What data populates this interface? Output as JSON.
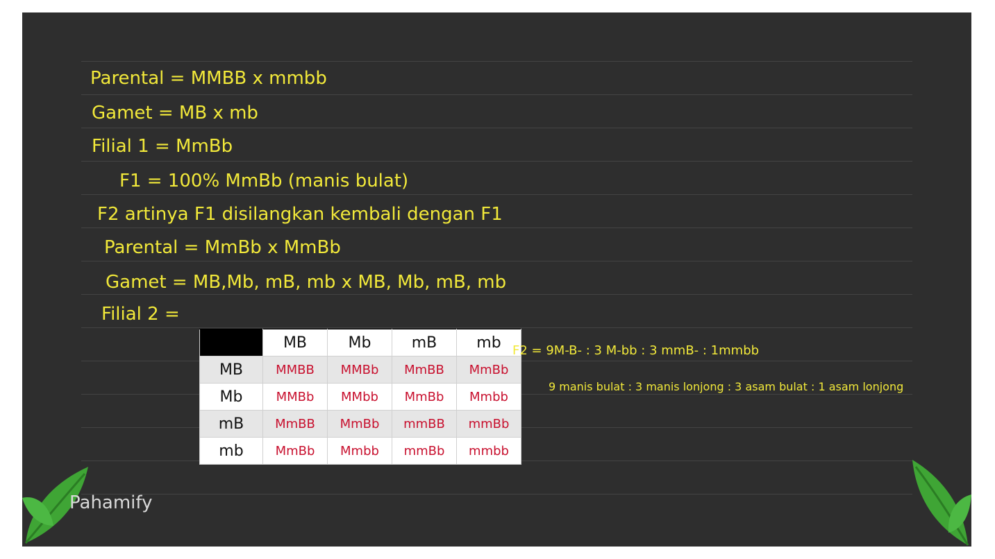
{
  "lines": [
    "Parental = MMBB x mmbb",
    "Gamet = MB x mb",
    "Filial 1 = MmBb",
    "F1 = 100% MmBb (manis bulat)",
    "F2 artinya F1 disilangkan kembali dengan F1",
    "Parental = MmBb x MmBb",
    "Gamet = MB,Mb, mB, mb x MB, Mb, mB, mb",
    "Filial 2 ="
  ],
  "punnett": {
    "columns": [
      "MB",
      "Mb",
      "mB",
      "mb"
    ],
    "rows": [
      {
        "head": "MB",
        "cells": [
          "MMBB",
          "MMBb",
          "MmBB",
          "MmBb"
        ]
      },
      {
        "head": "Mb",
        "cells": [
          "MMBb",
          "MMbb",
          "MmBb",
          "Mmbb"
        ]
      },
      {
        "head": "mB",
        "cells": [
          "MmBB",
          "MmBb",
          "mmBB",
          "mmBb"
        ]
      },
      {
        "head": "mb",
        "cells": [
          "MmBb",
          "Mmbb",
          "mmBb",
          "mmbb"
        ]
      }
    ]
  },
  "ratio": "F2 = 9M-B- : 3 M-bb : 3 mmB- : 1mmbb",
  "phenotype": "9 manis bulat : 3 manis lonjong : 3 asam bulat : 1 asam lonjong",
  "logo": "Pahamify",
  "colors": {
    "board": "#2e2e2e",
    "ink": "#f2e93a",
    "cell_ink": "#c8102e",
    "leaf": "#3fa535"
  }
}
